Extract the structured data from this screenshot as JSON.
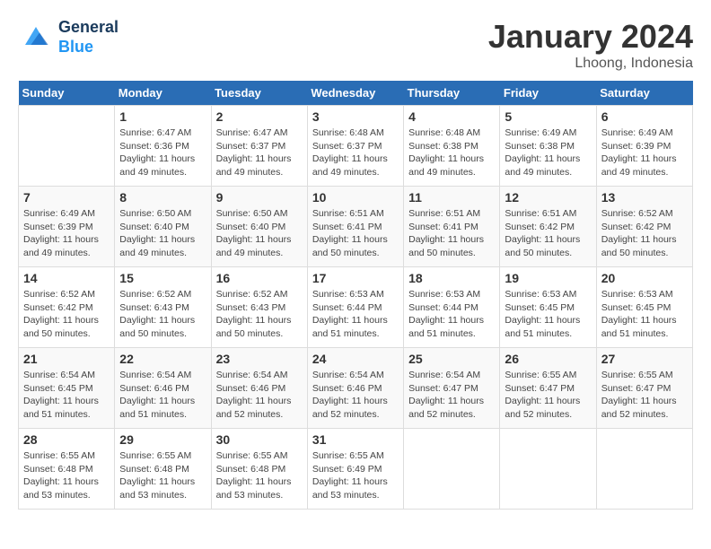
{
  "header": {
    "logo_line1": "General",
    "logo_line2": "Blue",
    "month_title": "January 2024",
    "location": "Lhoong, Indonesia"
  },
  "weekdays": [
    "Sunday",
    "Monday",
    "Tuesday",
    "Wednesday",
    "Thursday",
    "Friday",
    "Saturday"
  ],
  "weeks": [
    [
      {
        "day": "",
        "sunrise": "",
        "sunset": "",
        "daylight": ""
      },
      {
        "day": "1",
        "sunrise": "Sunrise: 6:47 AM",
        "sunset": "Sunset: 6:36 PM",
        "daylight": "Daylight: 11 hours and 49 minutes."
      },
      {
        "day": "2",
        "sunrise": "Sunrise: 6:47 AM",
        "sunset": "Sunset: 6:37 PM",
        "daylight": "Daylight: 11 hours and 49 minutes."
      },
      {
        "day": "3",
        "sunrise": "Sunrise: 6:48 AM",
        "sunset": "Sunset: 6:37 PM",
        "daylight": "Daylight: 11 hours and 49 minutes."
      },
      {
        "day": "4",
        "sunrise": "Sunrise: 6:48 AM",
        "sunset": "Sunset: 6:38 PM",
        "daylight": "Daylight: 11 hours and 49 minutes."
      },
      {
        "day": "5",
        "sunrise": "Sunrise: 6:49 AM",
        "sunset": "Sunset: 6:38 PM",
        "daylight": "Daylight: 11 hours and 49 minutes."
      },
      {
        "day": "6",
        "sunrise": "Sunrise: 6:49 AM",
        "sunset": "Sunset: 6:39 PM",
        "daylight": "Daylight: 11 hours and 49 minutes."
      }
    ],
    [
      {
        "day": "7",
        "sunrise": "Sunrise: 6:49 AM",
        "sunset": "Sunset: 6:39 PM",
        "daylight": "Daylight: 11 hours and 49 minutes."
      },
      {
        "day": "8",
        "sunrise": "Sunrise: 6:50 AM",
        "sunset": "Sunset: 6:40 PM",
        "daylight": "Daylight: 11 hours and 49 minutes."
      },
      {
        "day": "9",
        "sunrise": "Sunrise: 6:50 AM",
        "sunset": "Sunset: 6:40 PM",
        "daylight": "Daylight: 11 hours and 49 minutes."
      },
      {
        "day": "10",
        "sunrise": "Sunrise: 6:51 AM",
        "sunset": "Sunset: 6:41 PM",
        "daylight": "Daylight: 11 hours and 50 minutes."
      },
      {
        "day": "11",
        "sunrise": "Sunrise: 6:51 AM",
        "sunset": "Sunset: 6:41 PM",
        "daylight": "Daylight: 11 hours and 50 minutes."
      },
      {
        "day": "12",
        "sunrise": "Sunrise: 6:51 AM",
        "sunset": "Sunset: 6:42 PM",
        "daylight": "Daylight: 11 hours and 50 minutes."
      },
      {
        "day": "13",
        "sunrise": "Sunrise: 6:52 AM",
        "sunset": "Sunset: 6:42 PM",
        "daylight": "Daylight: 11 hours and 50 minutes."
      }
    ],
    [
      {
        "day": "14",
        "sunrise": "Sunrise: 6:52 AM",
        "sunset": "Sunset: 6:42 PM",
        "daylight": "Daylight: 11 hours and 50 minutes."
      },
      {
        "day": "15",
        "sunrise": "Sunrise: 6:52 AM",
        "sunset": "Sunset: 6:43 PM",
        "daylight": "Daylight: 11 hours and 50 minutes."
      },
      {
        "day": "16",
        "sunrise": "Sunrise: 6:52 AM",
        "sunset": "Sunset: 6:43 PM",
        "daylight": "Daylight: 11 hours and 50 minutes."
      },
      {
        "day": "17",
        "sunrise": "Sunrise: 6:53 AM",
        "sunset": "Sunset: 6:44 PM",
        "daylight": "Daylight: 11 hours and 51 minutes."
      },
      {
        "day": "18",
        "sunrise": "Sunrise: 6:53 AM",
        "sunset": "Sunset: 6:44 PM",
        "daylight": "Daylight: 11 hours and 51 minutes."
      },
      {
        "day": "19",
        "sunrise": "Sunrise: 6:53 AM",
        "sunset": "Sunset: 6:45 PM",
        "daylight": "Daylight: 11 hours and 51 minutes."
      },
      {
        "day": "20",
        "sunrise": "Sunrise: 6:53 AM",
        "sunset": "Sunset: 6:45 PM",
        "daylight": "Daylight: 11 hours and 51 minutes."
      }
    ],
    [
      {
        "day": "21",
        "sunrise": "Sunrise: 6:54 AM",
        "sunset": "Sunset: 6:45 PM",
        "daylight": "Daylight: 11 hours and 51 minutes."
      },
      {
        "day": "22",
        "sunrise": "Sunrise: 6:54 AM",
        "sunset": "Sunset: 6:46 PM",
        "daylight": "Daylight: 11 hours and 51 minutes."
      },
      {
        "day": "23",
        "sunrise": "Sunrise: 6:54 AM",
        "sunset": "Sunset: 6:46 PM",
        "daylight": "Daylight: 11 hours and 52 minutes."
      },
      {
        "day": "24",
        "sunrise": "Sunrise: 6:54 AM",
        "sunset": "Sunset: 6:46 PM",
        "daylight": "Daylight: 11 hours and 52 minutes."
      },
      {
        "day": "25",
        "sunrise": "Sunrise: 6:54 AM",
        "sunset": "Sunset: 6:47 PM",
        "daylight": "Daylight: 11 hours and 52 minutes."
      },
      {
        "day": "26",
        "sunrise": "Sunrise: 6:55 AM",
        "sunset": "Sunset: 6:47 PM",
        "daylight": "Daylight: 11 hours and 52 minutes."
      },
      {
        "day": "27",
        "sunrise": "Sunrise: 6:55 AM",
        "sunset": "Sunset: 6:47 PM",
        "daylight": "Daylight: 11 hours and 52 minutes."
      }
    ],
    [
      {
        "day": "28",
        "sunrise": "Sunrise: 6:55 AM",
        "sunset": "Sunset: 6:48 PM",
        "daylight": "Daylight: 11 hours and 53 minutes."
      },
      {
        "day": "29",
        "sunrise": "Sunrise: 6:55 AM",
        "sunset": "Sunset: 6:48 PM",
        "daylight": "Daylight: 11 hours and 53 minutes."
      },
      {
        "day": "30",
        "sunrise": "Sunrise: 6:55 AM",
        "sunset": "Sunset: 6:48 PM",
        "daylight": "Daylight: 11 hours and 53 minutes."
      },
      {
        "day": "31",
        "sunrise": "Sunrise: 6:55 AM",
        "sunset": "Sunset: 6:49 PM",
        "daylight": "Daylight: 11 hours and 53 minutes."
      },
      {
        "day": "",
        "sunrise": "",
        "sunset": "",
        "daylight": ""
      },
      {
        "day": "",
        "sunrise": "",
        "sunset": "",
        "daylight": ""
      },
      {
        "day": "",
        "sunrise": "",
        "sunset": "",
        "daylight": ""
      }
    ]
  ]
}
